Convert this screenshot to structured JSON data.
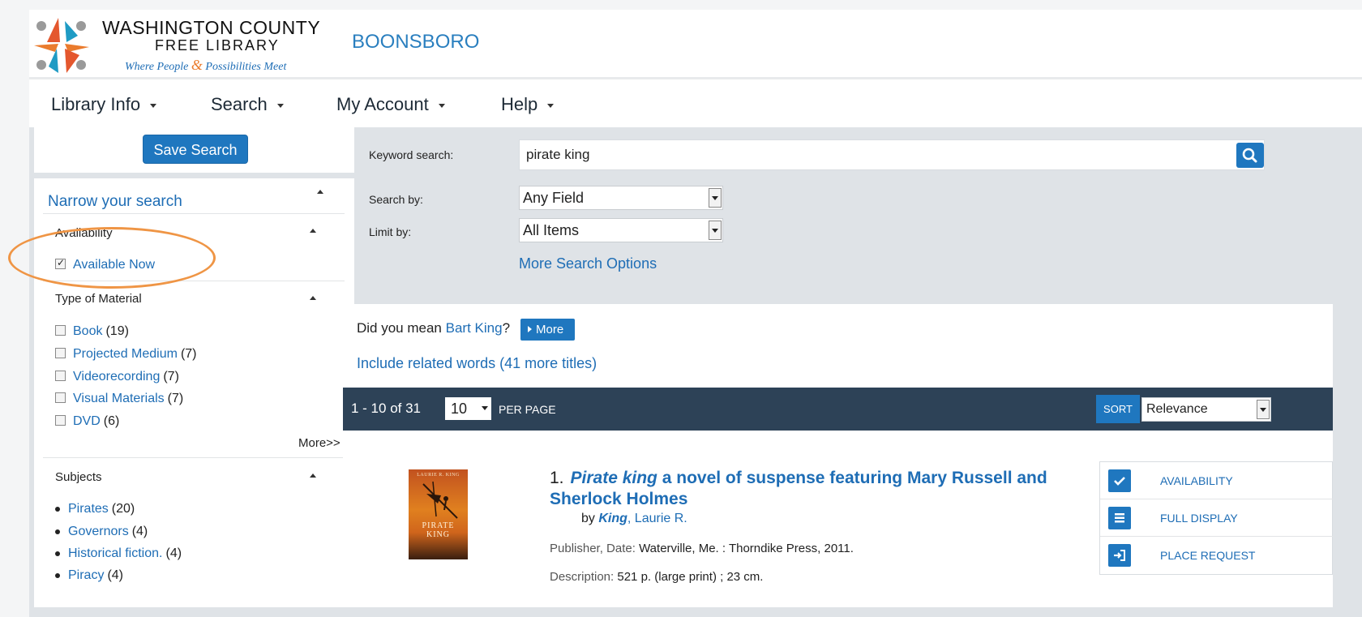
{
  "header": {
    "logo_title": "WASHINGTON COUNTY",
    "logo_subtitle": "FREE LIBRARY",
    "logo_tagline_1": "Where People",
    "logo_tagline_amp": "&",
    "logo_tagline_2": "Possibilities Meet",
    "branch": "BOONSBORO"
  },
  "nav": {
    "items": [
      {
        "label": "Library Info"
      },
      {
        "label": "Search"
      },
      {
        "label": "My Account"
      },
      {
        "label": "Help"
      }
    ]
  },
  "sidebar": {
    "save_search_label": "Save Search",
    "narrow_label": "Narrow your search",
    "availability": {
      "title": "Availability",
      "items": [
        {
          "label": "Available Now",
          "checked": true
        }
      ]
    },
    "material": {
      "title": "Type of Material",
      "items": [
        {
          "label": "Book",
          "count": "(19)"
        },
        {
          "label": "Projected Medium",
          "count": "(7)"
        },
        {
          "label": "Videorecording",
          "count": "(7)"
        },
        {
          "label": "Visual Materials",
          "count": "(7)"
        },
        {
          "label": "DVD",
          "count": "(6)"
        }
      ],
      "more_label": "More>>"
    },
    "subjects": {
      "title": "Subjects",
      "items": [
        {
          "label": "Pirates",
          "count": "(20)"
        },
        {
          "label": "Governors",
          "count": "(4)"
        },
        {
          "label": "Historical fiction.",
          "count": "(4)"
        },
        {
          "label": "Piracy",
          "count": "(4)"
        }
      ]
    }
  },
  "search": {
    "keyword_label": "Keyword search:",
    "keyword_value": "pirate king",
    "search_by_label": "Search by:",
    "search_by_value": "Any Field",
    "limit_by_label": "Limit by:",
    "limit_by_value": "All Items",
    "more_options_label": "More Search Options"
  },
  "results": {
    "did_you_mean_prefix": "Did you mean",
    "did_you_mean_term": "Bart King",
    "did_you_mean_suffix": "?",
    "more_button_label": "More",
    "related_words": "Include related words (41 more titles)",
    "range": "1 - 10 of 31",
    "per_page_value": "10",
    "per_page_label": "PER PAGE",
    "sort_label": "SORT",
    "sort_value": "Relevance"
  },
  "result_item": {
    "number": "1.",
    "title_italic": "Pirate king",
    "title_rest": "a novel of suspense featuring Mary Russell and Sherlock Holmes",
    "by_label": "by",
    "author_last": "King",
    "author_first": ", Laurie R.",
    "publisher_label": "Publisher, Date:",
    "publisher_value": "Waterville, Me. : Thorndike Press, 2011.",
    "description_label": "Description:",
    "description_value": "521 p. (large print) ; 23 cm.",
    "cover_author": "LAURIE R. KING",
    "cover_title_1": "PIRATE",
    "cover_title_2": "KING",
    "actions": [
      {
        "label": "AVAILABILITY",
        "icon": "check-icon"
      },
      {
        "label": "FULL DISPLAY",
        "icon": "list-icon"
      },
      {
        "label": "PLACE REQUEST",
        "icon": "sign-in-icon"
      }
    ]
  },
  "colors": {
    "accent_blue": "#1f77bf",
    "link_blue": "#1e6db5",
    "results_bar": "#2d4257",
    "annotation_orange": "#ef9545",
    "panel_gray": "#dfe3e7"
  }
}
